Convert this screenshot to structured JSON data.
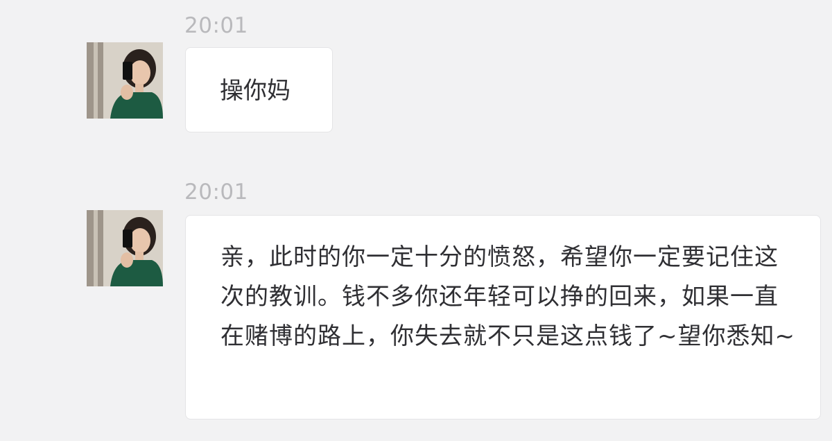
{
  "conversation": {
    "messages": [
      {
        "time": "20:01",
        "sender_avatar": "female-profile-photo",
        "text": "操你妈"
      },
      {
        "time": "20:01",
        "sender_avatar": "female-profile-photo",
        "text": "亲，此时的你一定十分的愤怒，希望你一定要记住这次的教训。钱不多你还年轻可以挣的回来，如果一直在赌博的路上，你失去就不只是这点钱了~望你悉知~"
      }
    ]
  },
  "colors": {
    "background": "#f2f2f3",
    "bubble": "#ffffff",
    "bubble_border": "#e4e4e6",
    "timestamp": "#b9b9bc",
    "text": "#2f2f33"
  }
}
